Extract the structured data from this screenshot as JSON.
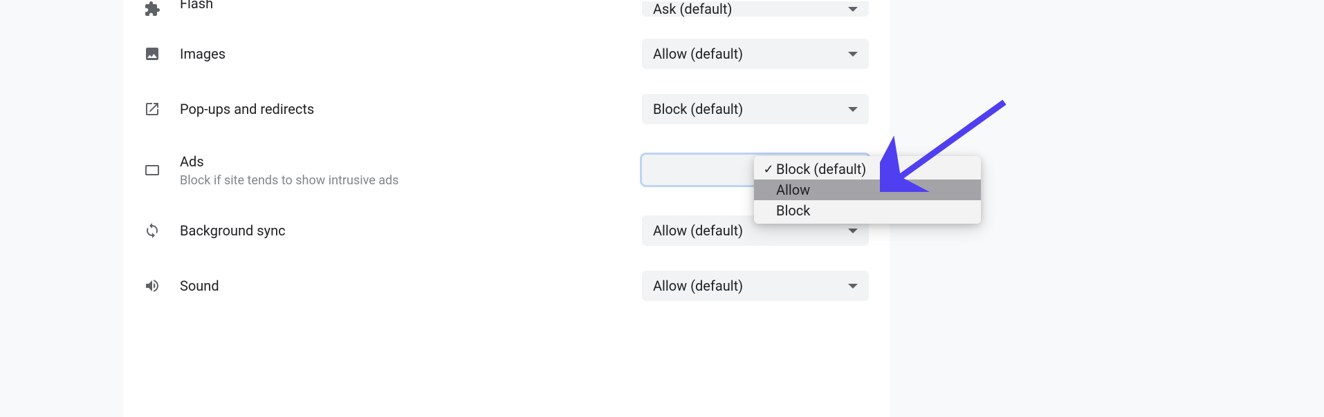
{
  "settings": {
    "flash": {
      "label": "Flash",
      "value": "Ask (default)"
    },
    "images": {
      "label": "Images",
      "value": "Allow (default)"
    },
    "popups": {
      "label": "Pop-ups and redirects",
      "value": "Block (default)"
    },
    "ads": {
      "label": "Ads",
      "sub": "Block if site tends to show intrusive ads",
      "value": ""
    },
    "bgsync": {
      "label": "Background sync",
      "value": "Allow (default)"
    },
    "sound": {
      "label": "Sound",
      "value": "Allow (default)"
    }
  },
  "ads_menu": {
    "options": {
      "0": {
        "label": "Block (default)",
        "checked": true,
        "highlight": false
      },
      "1": {
        "label": "Allow",
        "checked": false,
        "highlight": true
      },
      "2": {
        "label": "Block",
        "checked": false,
        "highlight": false
      }
    }
  }
}
